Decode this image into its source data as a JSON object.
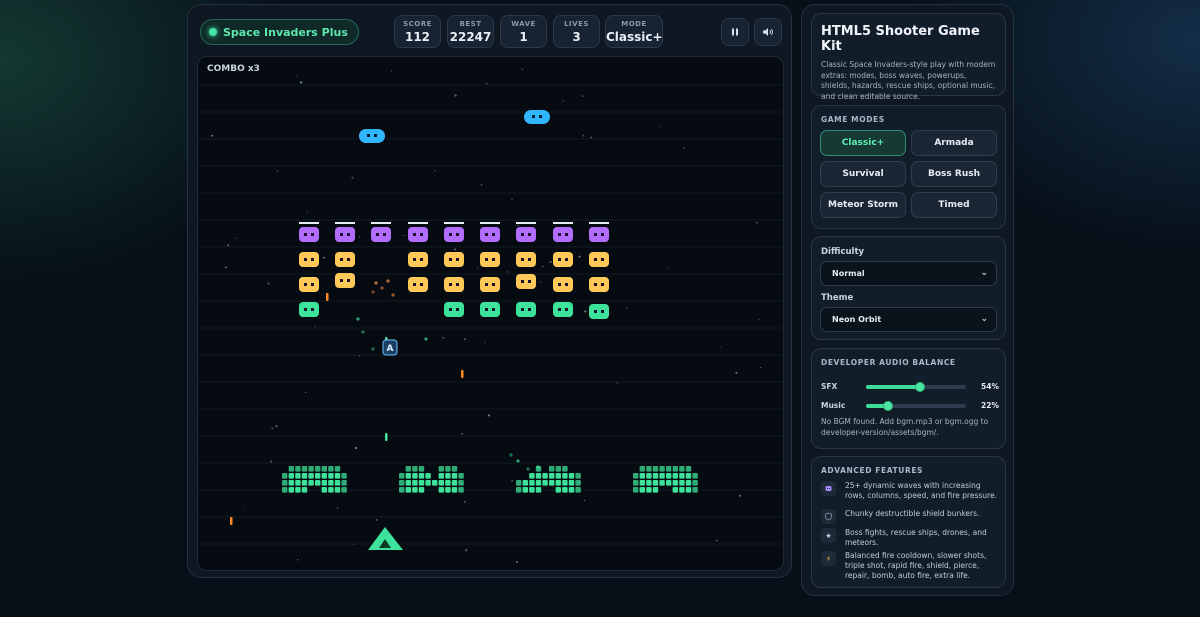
{
  "game": {
    "title": "Space Invaders Plus",
    "stats": [
      {
        "label": "SCORE",
        "value": "112"
      },
      {
        "label": "BEST",
        "value": "22247"
      },
      {
        "label": "WAVE",
        "value": "1"
      },
      {
        "label": "LIVES",
        "value": "3"
      },
      {
        "label": "MODE",
        "value": "Classic+"
      }
    ],
    "pause_icon": "pause-icon",
    "sound_icon": "speaker-icon",
    "combo": "COMBO x3",
    "powerup_letter": "A"
  },
  "sidebar": {
    "title": "HTML5 Shooter Game Kit",
    "description": "Classic Space Invaders-style play with modern extras: modes, boss waves, powerups, shields, hazards, rescue ships, optional music, and clean editable source.",
    "modes_heading": "GAME MODES",
    "modes": [
      {
        "label": "Classic+",
        "active": true
      },
      {
        "label": "Armada",
        "active": false
      },
      {
        "label": "Survival",
        "active": false
      },
      {
        "label": "Boss Rush",
        "active": false
      },
      {
        "label": "Meteor Storm",
        "active": false
      },
      {
        "label": "Timed",
        "active": false
      }
    ],
    "difficulty_label": "Difficulty",
    "difficulty_value": "Normal",
    "theme_label": "Theme",
    "theme_value": "Neon Orbit",
    "audio_heading": "DEVELOPER AUDIO BALANCE",
    "sfx_label": "SFX",
    "sfx_value": "54%",
    "sfx_level": 0.54,
    "music_label": "Music",
    "music_value": "22%",
    "music_level": 0.22,
    "audio_note": "No BGM found. Add bgm.mp3 or bgm.ogg to developer-version/assets/bgm/.",
    "features_heading": "ADVANCED FEATURES",
    "features": [
      {
        "icon": "wave-icon",
        "text": "25+ dynamic waves with increasing rows, columns, speed, and fire pressure."
      },
      {
        "icon": "shield-icon",
        "text": "Chunky destructible shield bunkers."
      },
      {
        "icon": "star-icon",
        "text": "Boss fights, rescue ships, drones, and meteors."
      },
      {
        "icon": "bolt-icon",
        "text": "Balanced fire cooldown, slower shots, triple shot, rapid fire, shield, pierce, repair, bomb, auto fire, extra life."
      }
    ]
  },
  "colors": {
    "accent": "#43e6a5",
    "invader_purple": "#b26cff",
    "invader_yellow": "#ffc95a",
    "invader_green": "#3ee39b",
    "ufo_blue": "#2fb6ff",
    "bullet_orange": "#ff8a1c"
  }
}
